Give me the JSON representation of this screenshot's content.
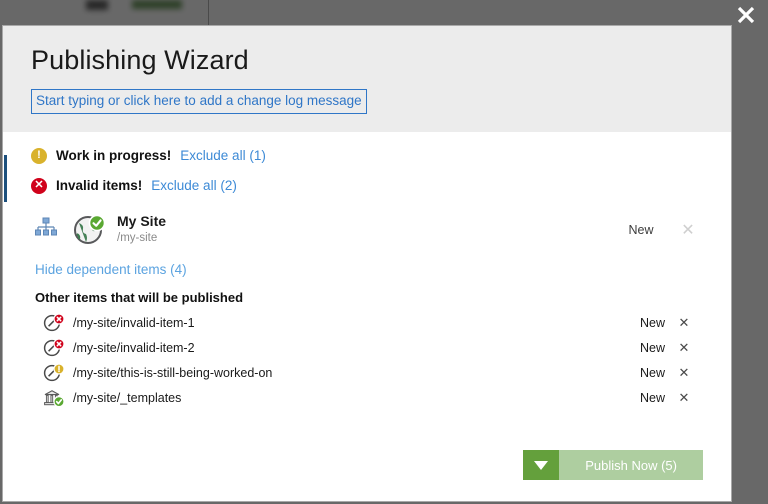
{
  "close_button": {
    "icon": "close-icon",
    "label": "✕"
  },
  "modal": {
    "title": "Publishing Wizard",
    "changelog_input": {
      "value": "Start typing or click here to add a change log message",
      "placeholder": "Start typing or click here to add a change log message"
    },
    "statuses": [
      {
        "icon": "warning-icon",
        "glyph": "!",
        "label": "Work in progress!",
        "link": "Exclude all (1)",
        "color": "#d9b22c"
      },
      {
        "icon": "error-icon",
        "glyph": "✕",
        "label": "Invalid items!",
        "link": "Exclude all (2)",
        "color": "#d0021b"
      }
    ],
    "site": {
      "tree_icon": "sitemap-icon",
      "item_icon": "globe-icon",
      "status_badge": "check-badge",
      "name": "My Site",
      "path": "/my-site",
      "state": "New",
      "remove": "✕"
    },
    "hide_dependent_link": "Hide dependent items (4)",
    "other_items_heading": "Other items that will be published",
    "dependent_items": [
      {
        "icon": "page-icon",
        "badge": "error-badge",
        "badge_glyph": "✕",
        "badge_color": "#d0021b",
        "path": "/my-site/invalid-item-1",
        "state": "New",
        "remove": "✕"
      },
      {
        "icon": "page-icon",
        "badge": "error-badge",
        "badge_glyph": "✕",
        "badge_color": "#d0021b",
        "path": "/my-site/invalid-item-2",
        "state": "New",
        "remove": "✕"
      },
      {
        "icon": "page-icon",
        "badge": "warning-badge",
        "badge_glyph": "!",
        "badge_color": "#d9b22c",
        "path": "/my-site/this-is-still-being-worked-on",
        "state": "New",
        "remove": "✕"
      },
      {
        "icon": "template-icon",
        "badge": "check-badge",
        "badge_glyph": "✓",
        "badge_color": "#5aa832",
        "path": "/my-site/_templates",
        "state": "New",
        "remove": "✕"
      }
    ],
    "footer": {
      "dropdown_icon": "chevron-down-icon",
      "publish_label": "Publish Now (5)"
    }
  },
  "colors": {
    "accent_blue": "#2f76c7",
    "link_blue": "#3d8ad6",
    "light_link_blue": "#5ba3e0",
    "warning": "#d9b22c",
    "error": "#d0021b",
    "success": "#5aa832",
    "publish_green": "#64a03c",
    "publish_green_disabled": "#aecea0",
    "header_bg": "#ececec",
    "scrim": "#646464"
  }
}
